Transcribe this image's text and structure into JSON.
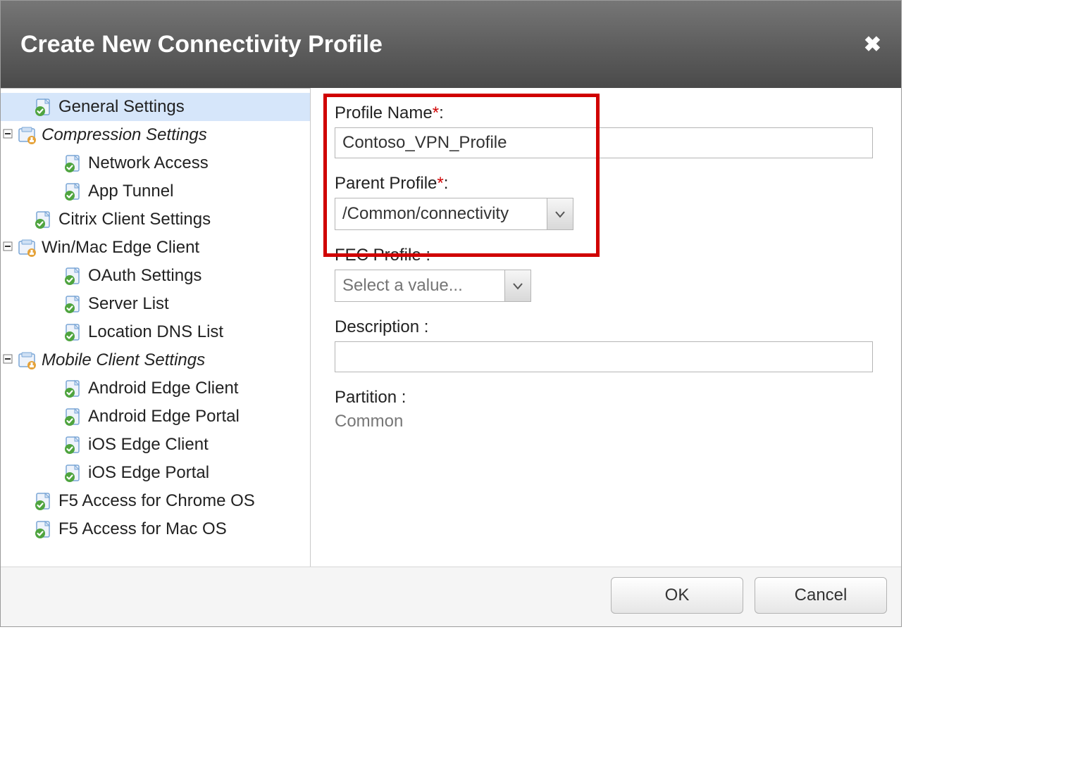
{
  "header": {
    "title": "Create New Connectivity Profile",
    "close_label": "✖"
  },
  "tree": {
    "general_settings": "General Settings",
    "compression_settings": "Compression Settings",
    "network_access": "Network Access",
    "app_tunnel": "App Tunnel",
    "citrix_client_settings": "Citrix Client Settings",
    "winmac_edge_client": "Win/Mac Edge Client",
    "oauth_settings": "OAuth Settings",
    "server_list": "Server List",
    "location_dns_list": "Location DNS List",
    "mobile_client_settings": "Mobile Client Settings",
    "android_edge_client": "Android Edge Client",
    "android_edge_portal": "Android Edge Portal",
    "ios_edge_client": "iOS Edge Client",
    "ios_edge_portal": "iOS Edge Portal",
    "f5_chrome": "F5 Access for Chrome OS",
    "f5_mac": "F5 Access for Mac OS"
  },
  "form": {
    "profile_name_label": "Profile Name",
    "profile_name_value": "Contoso_VPN_Profile",
    "parent_profile_label": "Parent Profile",
    "parent_profile_value": "/Common/connectivity",
    "fec_profile_label": "FEC Profile",
    "fec_profile_placeholder": "Select a value...",
    "description_label": "Description",
    "description_value": "",
    "partition_label": "Partition",
    "partition_value": "Common",
    "colon": ":",
    "star": "*"
  },
  "footer": {
    "ok": "OK",
    "cancel": "Cancel"
  }
}
